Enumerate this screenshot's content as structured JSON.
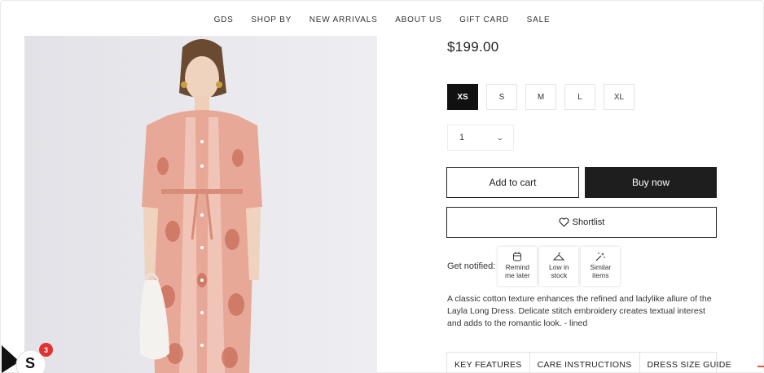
{
  "nav": {
    "items": [
      "GDS",
      "SHOP BY",
      "NEW ARRIVALS",
      "ABOUT US",
      "GIFT CARD",
      "SALE"
    ]
  },
  "product": {
    "price": "$199.00",
    "sizes": [
      "XS",
      "S",
      "M",
      "L",
      "XL"
    ],
    "selected_size": "XS",
    "quantity": "1",
    "add_to_cart_label": "Add to cart",
    "buy_now_label": "Buy now",
    "shortlist_label": "Shortlist",
    "description": "A classic cotton texture enhances the refined and ladylike allure of the Layla Long Dress. Delicate stitch embroidery creates textual interest and adds to the romantic look. - lined"
  },
  "notify": {
    "label": "Get notified:",
    "options": [
      {
        "line1": "Remind",
        "line2": "me later",
        "icon": "calendar-icon"
      },
      {
        "line1": "Low in",
        "line2": "stock",
        "icon": "hanger-icon"
      },
      {
        "line1": "Similar",
        "line2": "items",
        "icon": "magic-wand-icon"
      }
    ]
  },
  "tabs": [
    "KEY FEATURES",
    "CARE INSTRUCTIONS",
    "DRESS SIZE GUIDE"
  ],
  "widget": {
    "badge_count": "3",
    "logo_letter": "S"
  },
  "colors": {
    "accent_dark": "#1e1e1e",
    "badge_red": "#e33030",
    "dress_pink": "#e8a898"
  }
}
